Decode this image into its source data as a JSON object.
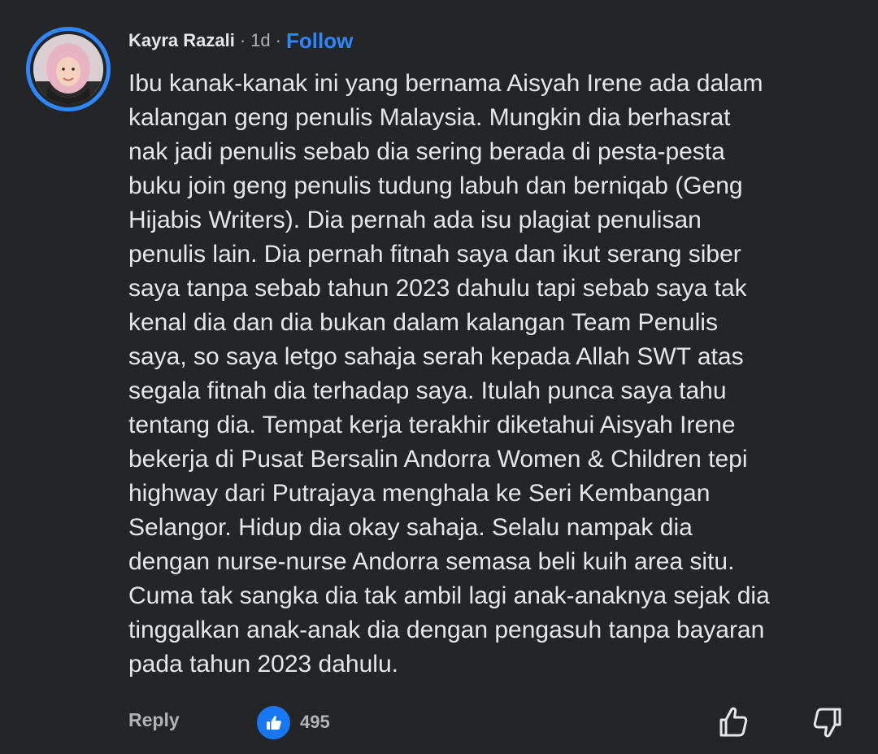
{
  "comment": {
    "author": "Kayra Razali",
    "separator_1": "·",
    "time": "1d",
    "separator_2": "·",
    "follow_label": "Follow",
    "body_lines": [
      "Ibu kanak-kanak ini yang bernama Aisyah Irene ada dalam",
      "kalangan geng penulis Malaysia. Mungkin dia berhasrat",
      "nak jadi penulis sebab dia sering berada di pesta-pesta",
      "buku join geng penulis tudung labuh dan berniqab (Geng",
      "Hijabis Writers). Dia pernah ada isu plagiat penulisan",
      "penulis lain. Dia pernah fitnah saya dan ikut serang siber",
      "saya tanpa sebab tahun 2023 dahulu tapi sebab saya tak",
      "kenal dia dan dia bukan dalam kalangan Team Penulis",
      "saya, so saya letgo sahaja serah kepada Allah SWT atas",
      "segala fitnah dia terhadap saya. Itulah punca saya tahu",
      "tentang dia. Tempat kerja terakhir diketahui Aisyah Irene",
      "bekerja di Pusat Bersalin Andorra Women & Children tepi",
      "highway dari Putrajaya menghala ke Seri Kembangan",
      "Selangor. Hidup dia okay sahaja. Selalu nampak dia",
      "dengan nurse-nurse Andorra semasa beli kuih area situ.",
      "Cuma tak sangka dia tak ambil lagi anak-anaknya sejak dia",
      "tinggalkan anak-anak dia dengan pengasuh tanpa bayaran",
      "pada tahun 2023 dahulu."
    ],
    "reply_label": "Reply",
    "like_count": "495",
    "icons": {
      "avatar": "avatar-photo",
      "like_badge": "like-badge-icon",
      "thumb_up": "thumb-up-icon",
      "thumb_down": "thumb-down-icon"
    },
    "colors": {
      "background": "#242526",
      "text": "#e4e6eb",
      "muted": "#b0b3b8",
      "accent": "#2d88ff",
      "like_badge": "#1877f2"
    }
  }
}
